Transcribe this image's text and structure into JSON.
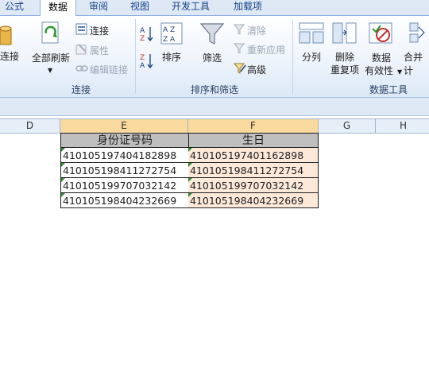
{
  "tabs": [
    "公式",
    "数据",
    "审阅",
    "视图",
    "开发工具",
    "加载项"
  ],
  "ribbon": {
    "connections": {
      "connect_partial": "连接",
      "refresh_all": "全部刷新",
      "connections": "连接",
      "properties": "属性",
      "edit_links": "编辑链接",
      "group_label": "连接"
    },
    "sort_filter": {
      "sort": "排序",
      "filter": "筛选",
      "clear": "清除",
      "reapply": "重新应用",
      "advanced": "高级",
      "group_label": "排序和筛选"
    },
    "data_tools": {
      "text_to_columns": "分列",
      "remove_duplicates_1": "删除",
      "remove_duplicates_2": "重复项",
      "validation_1": "数据",
      "validation_2": "有效性",
      "consolidate": "合并计",
      "group_label": "数据工具"
    }
  },
  "grid": {
    "columns": [
      "D",
      "E",
      "F",
      "G",
      "H"
    ],
    "header": {
      "e": "身份证号码",
      "f": "生日"
    },
    "rows": [
      {
        "e": "410105197404182898",
        "f": "410105197401162898"
      },
      {
        "e": "410105198411272754",
        "f": "410105198411272754"
      },
      {
        "e": "410105199707032142",
        "f": "410105199707032142"
      },
      {
        "e": "410105198404232669",
        "f": "410105198404232669"
      }
    ]
  },
  "colors": {
    "accent": "#15428b",
    "header_fill": "#bfbfbf",
    "birthday_fill": "#fde9d9",
    "error_marker": "#2e8b2e"
  }
}
